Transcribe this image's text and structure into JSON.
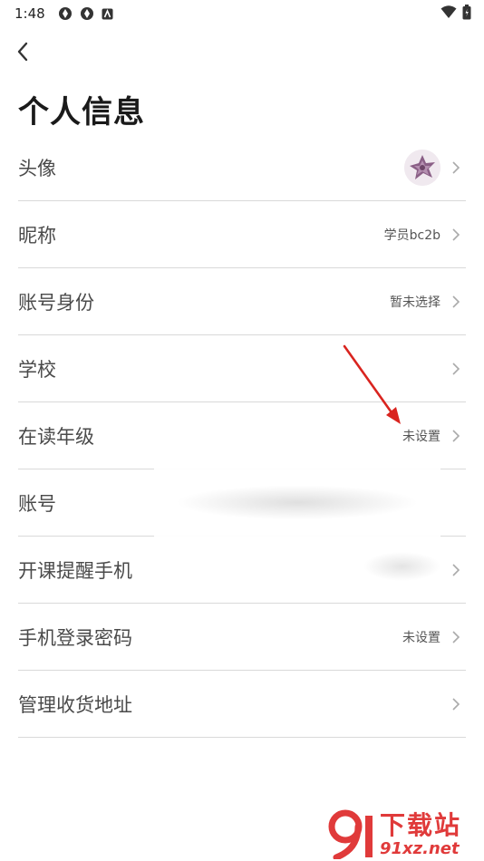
{
  "status_bar": {
    "time": "1:48",
    "icons": [
      "app-icon",
      "app-icon",
      "notification-icon"
    ],
    "right_icons": [
      "wifi-icon",
      "battery-icon"
    ]
  },
  "header": {
    "back_icon": "chevron-left-icon",
    "title": "个人信息"
  },
  "rows": [
    {
      "label": "头像",
      "value": "",
      "has_avatar": true
    },
    {
      "label": "昵称",
      "value": "学员bc2b"
    },
    {
      "label": "账号身份",
      "value": "暂未选择"
    },
    {
      "label": "学校",
      "value": ""
    },
    {
      "label": "在读年级",
      "value": "未设置"
    },
    {
      "label": "账号",
      "value": ""
    },
    {
      "label": "开课提醒手机",
      "value": ""
    },
    {
      "label": "手机登录密码",
      "value": "未设置"
    },
    {
      "label": "管理收货地址",
      "value": ""
    }
  ],
  "watermark": {
    "brand": "下载站",
    "url": "91xz.net"
  },
  "colors": {
    "annotation_arrow": "#d9241f",
    "watermark": "#e03a3a",
    "divider": "#d9d9d9"
  }
}
